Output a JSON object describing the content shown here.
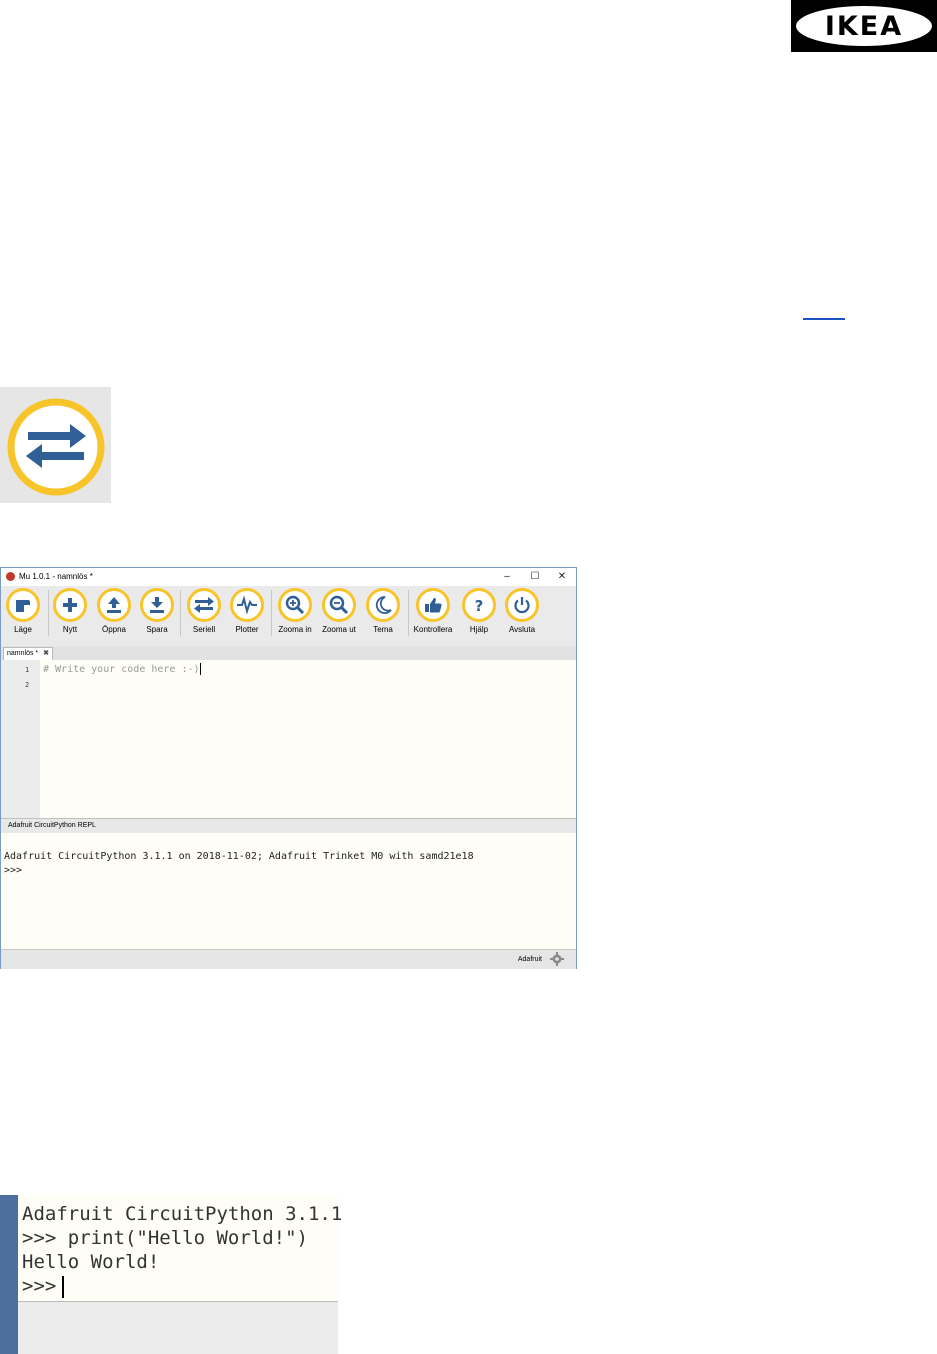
{
  "logo": {
    "text": "IKEA"
  },
  "mu": {
    "title": "Mu 1.0.1 - namnlös *",
    "window_controls": {
      "minimize": "–",
      "maximize": "☐",
      "close": "✕"
    },
    "toolbar": [
      {
        "label": "Läge",
        "icon": "mode-icon"
      },
      {
        "label": "Nytt",
        "icon": "plus-icon"
      },
      {
        "label": "Öppna",
        "icon": "upload-icon"
      },
      {
        "label": "Spara",
        "icon": "download-icon"
      },
      {
        "label": "Seriell",
        "icon": "serial-arrows-icon"
      },
      {
        "label": "Plotter",
        "icon": "pulse-icon"
      },
      {
        "label": "Zooma in",
        "icon": "zoom-in-icon"
      },
      {
        "label": "Zooma ut",
        "icon": "zoom-out-icon"
      },
      {
        "label": "Tema",
        "icon": "moon-icon"
      },
      {
        "label": "Kontrollera",
        "icon": "thumbs-up-icon"
      },
      {
        "label": "Hjälp",
        "icon": "question-icon"
      },
      {
        "label": "Avsluta",
        "icon": "power-icon"
      }
    ],
    "tab": {
      "label": "namnlös *",
      "close": "✖"
    },
    "editor": {
      "lines": [
        "1",
        "2"
      ],
      "code": "# Write your code here :-)"
    },
    "repl": {
      "header": "Adafruit CircuitPython REPL",
      "line1": "Adafruit CircuitPython 3.1.1 on 2018-11-02; Adafruit Trinket M0 with samd21e18",
      "line2": ">>>"
    },
    "status": {
      "mode": "Adafruit"
    }
  },
  "crop": {
    "line1": "Adafruit CircuitPython 3.1.1",
    "line2": ">>> print(\"Hello World!\")",
    "line3": "Hello World!",
    "line4": ">>>"
  },
  "colors": {
    "accent_ring": "#f7c52a",
    "icon_blue": "#2f5f95"
  }
}
